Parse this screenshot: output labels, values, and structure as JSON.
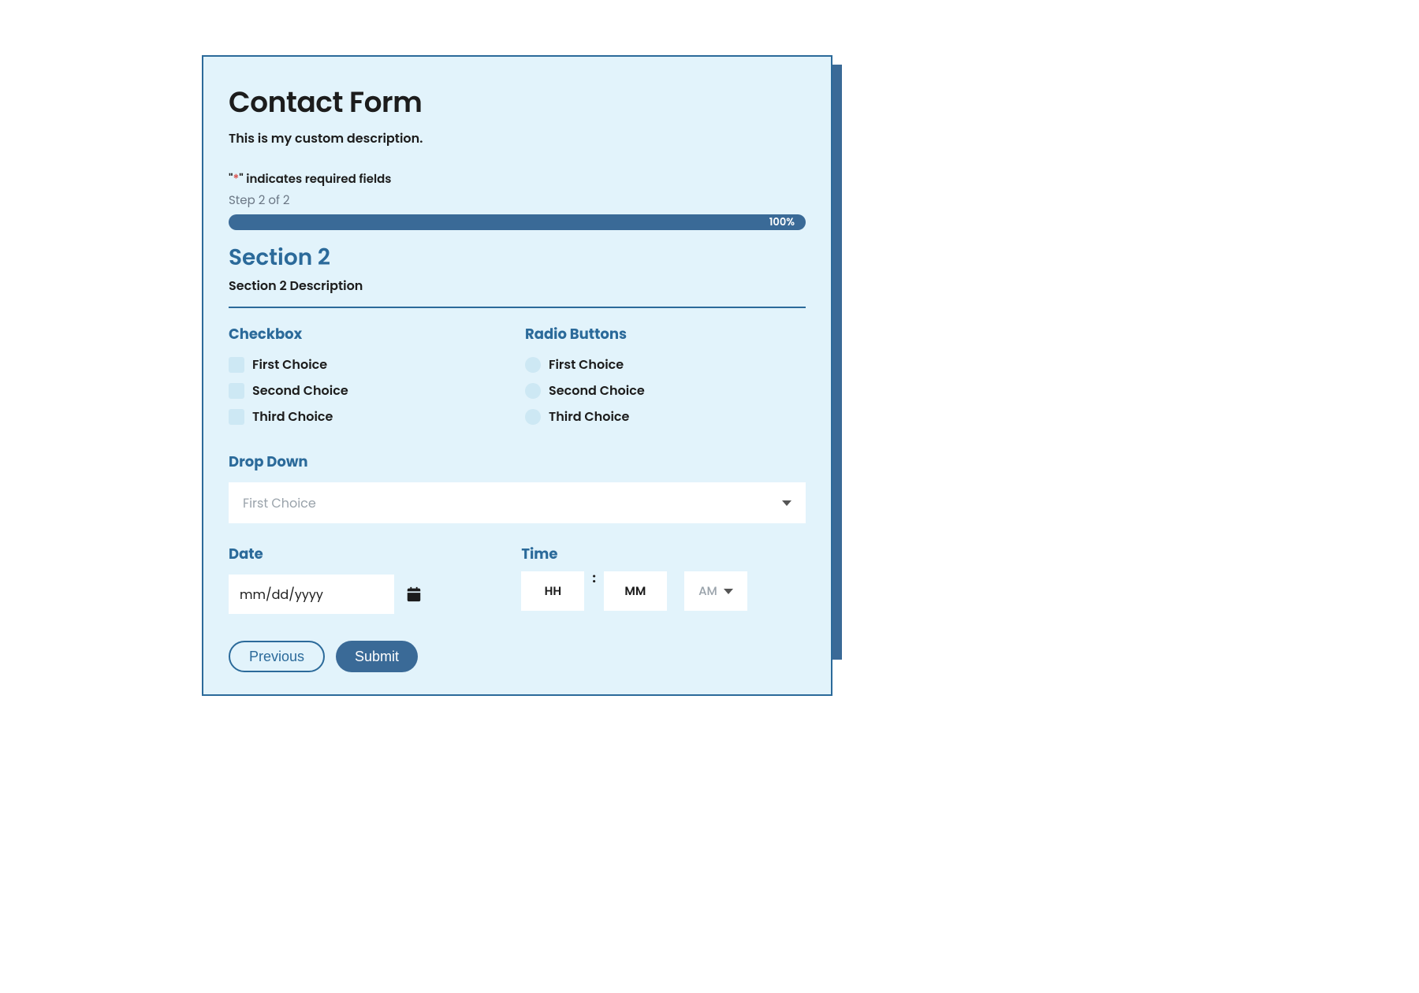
{
  "form": {
    "title": "Contact Form",
    "description": "This is my custom description.",
    "required_note_prefix": "\"",
    "required_note_star": "*",
    "required_note_suffix": "\" indicates required fields",
    "step_label": "Step 2 of 2",
    "progress_text": "100%"
  },
  "section": {
    "title": "Section 2",
    "description": "Section 2 Description"
  },
  "checkbox": {
    "label": "Checkbox",
    "options": [
      "First Choice",
      "Second Choice",
      "Third Choice"
    ]
  },
  "radio": {
    "label": "Radio Buttons",
    "options": [
      "First Choice",
      "Second Choice",
      "Third Choice"
    ]
  },
  "dropdown": {
    "label": "Drop Down",
    "value": "First Choice"
  },
  "date": {
    "label": "Date",
    "placeholder": "mm/dd/yyyy"
  },
  "time": {
    "label": "Time",
    "hh": "HH",
    "mm": "MM",
    "ampm": "AM"
  },
  "buttons": {
    "previous": "Previous",
    "submit": "Submit"
  }
}
